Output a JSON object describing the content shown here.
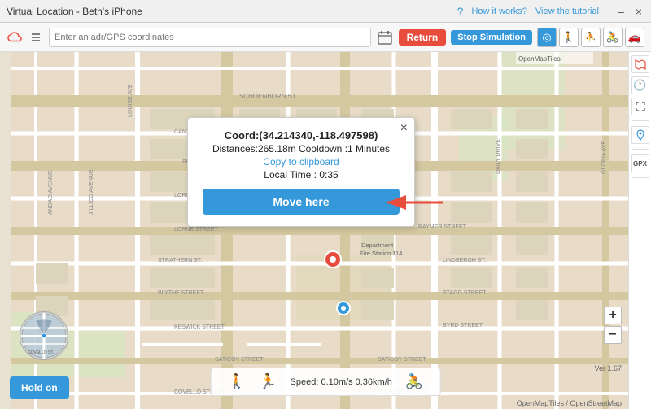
{
  "titlebar": {
    "title": "Virtual Location - Beth's iPhone",
    "how_label": "How it works?",
    "tutorial_label": "View the tutorial",
    "min_label": "–",
    "close_label": "×"
  },
  "toolbar": {
    "input_placeholder": "Enter an adr/GPS coordinates",
    "return_label": "Return",
    "stop_sim_label": "Stop Simulation"
  },
  "popup": {
    "coord_label": "Coord:(34.214340,-118.497598)",
    "distances_label": "Distances:265.18m Cooldown :1 Minutes",
    "copy_label": "Copy to clipboard",
    "time_label": "Local Time : 0:35",
    "move_here_label": "Move here",
    "close_label": "×"
  },
  "speed_bar": {
    "speed_label": "Speed: 0.10m/s 0.36km/h"
  },
  "hold_on": {
    "label": "Hold on"
  },
  "sidebar": {
    "buttons": [
      "◎",
      "🚶",
      "⛹",
      "🚴",
      "🚗"
    ]
  },
  "map": {
    "attribution": "OpenMapTiles / OpenStreetMap",
    "osm_label": "OpenMapTiles"
  },
  "version": {
    "label": "Ver 1.67"
  },
  "zoom": {
    "plus": "+",
    "minus": "−"
  }
}
